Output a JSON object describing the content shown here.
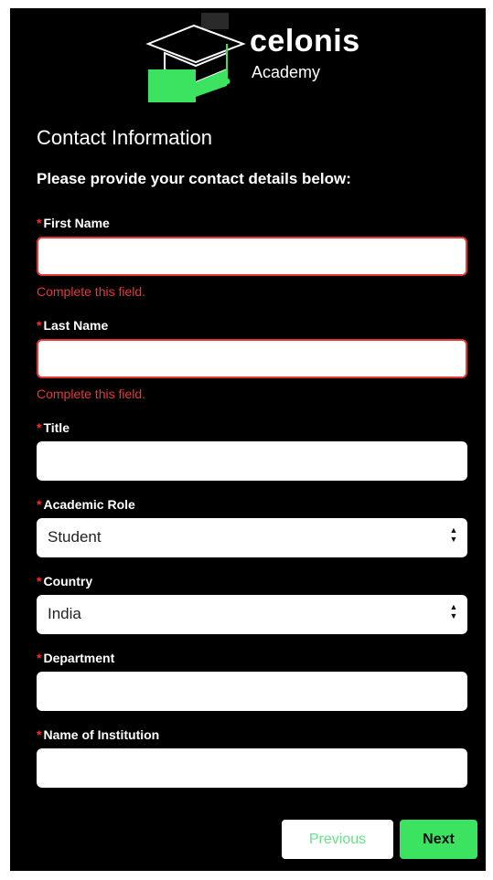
{
  "brand": {
    "name": "celonis",
    "sub": "Academy",
    "accent": "#3ce361"
  },
  "form": {
    "heading": "Contact Information",
    "subheading": "Please provide your contact details below:",
    "required_mark": "*",
    "error_message": "Complete this field.",
    "fields": {
      "first_name": {
        "label": "First Name",
        "value": "",
        "error": true
      },
      "last_name": {
        "label": "Last Name",
        "value": "",
        "error": true
      },
      "title": {
        "label": "Title",
        "value": ""
      },
      "academic_role": {
        "label": "Academic Role",
        "value": "Student"
      },
      "country": {
        "label": "Country",
        "value": "India"
      },
      "department": {
        "label": "Department",
        "value": ""
      },
      "institution": {
        "label": "Name of Institution",
        "value": ""
      }
    }
  },
  "buttons": {
    "previous": "Previous",
    "next": "Next"
  },
  "colors": {
    "background": "#000000",
    "error": "#e53935",
    "required": "#ff2b2b"
  }
}
